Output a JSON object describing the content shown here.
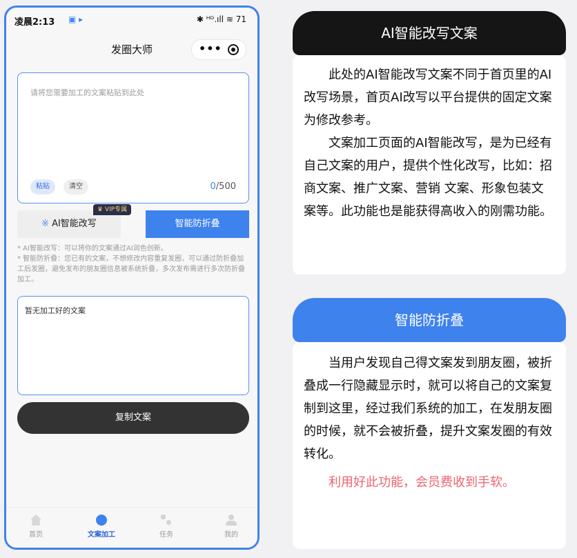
{
  "status_bar": {
    "time": "凌晨2:13",
    "icons": "✱ ᵸᴰ.ıll ≋ 71"
  },
  "navbar": {
    "title": "发圈大师",
    "more": "•••"
  },
  "input": {
    "placeholder": "请将您需要加工的文案粘贴到此处",
    "paste_label": "粘贴",
    "clear_label": "清空",
    "counter_current": "0",
    "counter_max": "/500"
  },
  "modes": {
    "ai_label": "AI智能改写",
    "ai_icon": "sparkle-icon",
    "fold_label": "智能防折叠",
    "vip_badge": "♛ VIP专属"
  },
  "notes": [
    "* AI智能改写：可以将你的文案通过AI润色创新。",
    "* 智能防折叠：您已有的文案，不想修改内容重复发圈，可以通过防折叠加工后发圈，避免发布的朋友圈信息被系统折叠，多次发布需进行多次防折叠加工。"
  ],
  "output": {
    "empty_text": "暂无加工好的文案"
  },
  "copy_button": "复制文案",
  "tabs": [
    {
      "label": "首页",
      "icon": "home-icon",
      "active": false
    },
    {
      "label": "文案加工",
      "icon": "edit-icon",
      "active": true
    },
    {
      "label": "任务",
      "icon": "task-icon",
      "active": false
    },
    {
      "label": "我的",
      "icon": "profile-icon",
      "active": false
    }
  ],
  "section_ai": {
    "header": "AI智能改写文案",
    "color": "#151515",
    "paragraphs": [
      "此处的AI智能改写文案不同于首页里的AI改写场景，首页AI改写以平台提供的固定文案为修改参考。",
      "文案加工页面的AI智能改写，是为已经有自己文案的用户，提供个性化改写，比如：招商文案、推广文案、营销 文案、形象包装文案等。此功能也是能获得高收入的刚需功能。"
    ]
  },
  "section_fold": {
    "header": "智能防折叠",
    "color": "#3e82ee",
    "paragraphs": [
      "当用户发现自己得文案发到朋友圈，被折叠成一行隐藏显示时，就可以将自己的文案复制到这里，经过我们系统的加工，在发朋友圈的时候，就不会被折叠，提升文案发圈的有效转化。"
    ],
    "highlight": "利用好此功能，会员费收到手软。"
  }
}
